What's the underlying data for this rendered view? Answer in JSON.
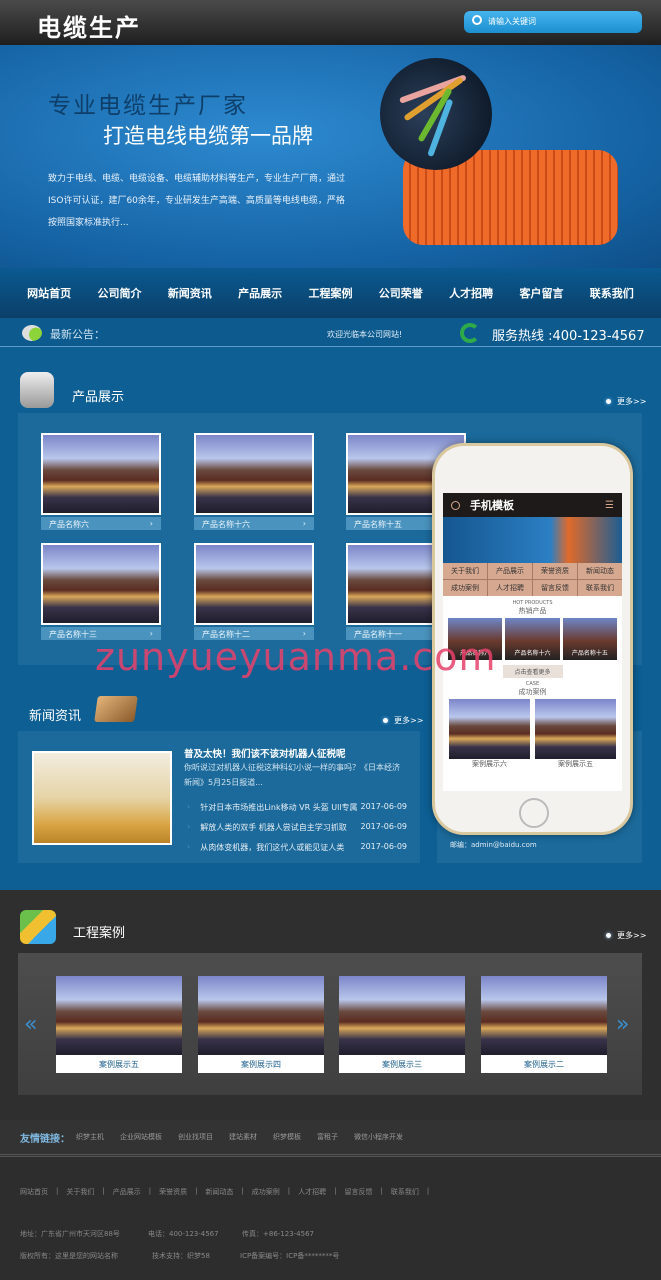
{
  "header": {
    "logo": "电缆生产",
    "search_placeholder": "请输入关键词"
  },
  "banner": {
    "headline1": "专业电缆生产厂家",
    "headline2": "打造电线电缆第一品牌",
    "description": "致力于电线、电缆、电缆设备、电缆辅助材料等生产，专业生产厂商，通过ISO许可认证，建厂60余年，专业研发生产高端、高质量等电线电缆，严格按照国家标准执行..."
  },
  "nav": [
    "网站首页",
    "公司简介",
    "新闻资讯",
    "产品展示",
    "工程案例",
    "公司荣誉",
    "人才招聘",
    "客户留言",
    "联系我们"
  ],
  "notice": {
    "label": "最新公告：",
    "text": "欢迎光临本公司网站!",
    "hotline": "服务热线 :400-123-4567"
  },
  "products": {
    "title": "产品展示",
    "more": "更多>>",
    "items": [
      "产品名称六",
      "产品名称十六",
      "产品名称十五",
      "产品名称十三",
      "产品名称十二",
      "产品名称十一"
    ]
  },
  "news": {
    "title": "新闻资讯",
    "more": "更多>>",
    "headline": "普及太快！我们该不该对机器人征税呢",
    "summary": "你听说过对机器人征税这种科幻小说一样的事吗？《日本经济新闻》5月25日报道...",
    "items": [
      {
        "title": "针对日本市场推出Link移动 VR 头盔 Ull专属",
        "date": "2017-06-09"
      },
      {
        "title": "解放人类的双手 机器人尝试自主学习抓取",
        "date": "2017-06-09"
      },
      {
        "title": "从肉体变机器，我们这代人或能见证人类",
        "date": "2017-06-09"
      }
    ]
  },
  "contact": {
    "email": "邮编：admin@baidu.com"
  },
  "phone": {
    "title": "手机模板",
    "menu": [
      "关于我们",
      "产品展示",
      "荣誉资质",
      "新闻动态",
      "成功案例",
      "人才招聘",
      "留言反馈",
      "联系我们"
    ],
    "hot_en": "HOT PRODUCTS",
    "hot_cn": "热销产品",
    "products": [
      "产品名称六",
      "产品名称十六",
      "产品名称十五"
    ],
    "more_button": "点击查看更多",
    "case_en": "CASE",
    "case_cn": "成功案例",
    "cases": [
      "案例展示六",
      "案例展示五"
    ]
  },
  "watermark": "zunyueyuanma.com",
  "cases": {
    "title": "工程案例",
    "more": "更多>>",
    "items": [
      "案例展示五",
      "案例展示四",
      "案例展示三",
      "案例展示二"
    ]
  },
  "friend_links": {
    "label": "友情链接：",
    "items": [
      "织梦主机",
      "企业网站模板",
      "创业找项目",
      "建站素材",
      "织梦模板",
      "富租子",
      "微信小程序开发"
    ]
  },
  "footer": {
    "nav": [
      "网站首页",
      "关于我们",
      "产品展示",
      "荣誉资质",
      "新闻动态",
      "成功案例",
      "人才招聘",
      "留言反馈",
      "联系我们"
    ],
    "address": "地址：广东省广州市天河区88号",
    "phone": "电话：400-123-4567",
    "fax": "传真：+86-123-4567",
    "copyright": "版权所有：这里是您的网站名称",
    "support": "技术支持：织梦58",
    "icp": "ICP备案编号：ICP备********号"
  }
}
